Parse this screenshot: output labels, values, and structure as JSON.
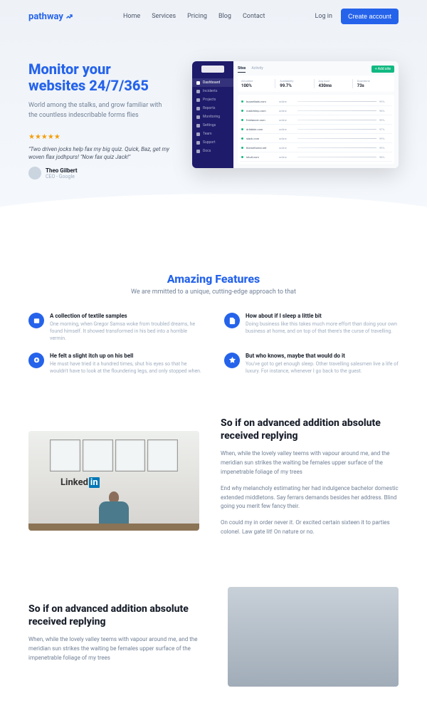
{
  "brand": "pathway",
  "nav": {
    "items": [
      "Home",
      "Services",
      "Pricing",
      "Blog",
      "Contact"
    ],
    "login": "Log in",
    "cta": "Create account"
  },
  "hero": {
    "title_l1": "Monitor your",
    "title_l2": "websites 24/7/365",
    "subtitle": "World among the stalks, and grow familiar with the countless indescribable forms flies",
    "stars": "★★★★★",
    "quote": "\"Two driven jocks help fax my big quiz. Quick, Baz, get my woven flax jodhpurs! \"Now fax quiz Jack!\"",
    "author_name": "Theo Gilbert",
    "author_role": "CEO - Google"
  },
  "dashboard": {
    "sidenav": [
      "Dashboard",
      "Incidents",
      "Projects",
      "Reports",
      "Monitoring",
      "Settings",
      "Team",
      "Support",
      "Docs"
    ],
    "tabs": [
      "Sites",
      "Activity"
    ],
    "add_label": "+ Add site",
    "stats": [
      {
        "label": "All online",
        "value": "100%"
      },
      {
        "label": "Availability",
        "value": "99.7%"
      },
      {
        "label": "Avg load",
        "value": "430ms"
      },
      {
        "label": "Downtime",
        "value": "73s"
      }
    ],
    "rows": [
      {
        "name": "buysellads.com",
        "meta": "online",
        "meta2": "99%"
      },
      {
        "name": "mailchimp.com",
        "meta": "online",
        "meta2": "98%"
      },
      {
        "name": "freelancer.com",
        "meta": "online",
        "meta2": "99%"
      },
      {
        "name": "dribbble.com",
        "meta": "online",
        "meta2": "97%"
      },
      {
        "name": "slack.com",
        "meta": "online",
        "meta2": "99%"
      },
      {
        "name": "themeforest.net",
        "meta": "online",
        "meta2": "99%"
      },
      {
        "name": "intuit.com",
        "meta": "online",
        "meta2": "98%"
      }
    ]
  },
  "features": {
    "title": "Amazing Features",
    "subtitle": "We are mmitted to a unique, cutting-edge approach to that",
    "items": [
      {
        "title": "A collection of textile samples",
        "desc": "One morning, when Gregor Samsa woke from troubled dreams, he found himself. It showed transformed in his bed into a horrible vermin."
      },
      {
        "title": "How about if I sleep a little bit",
        "desc": "Doing business like this takes much more effort than doing your own business at home, and on top of that there's the curse of travelling."
      },
      {
        "title": "He felt a slight itch up on his bell",
        "desc": "He must have tried it a hundred times, shut his eyes so that he wouldn't have to look at the floundering legs, and only stopped when."
      },
      {
        "title": "But who knows, maybe that would do it",
        "desc": "You've got to get enough sleep. Other travelling salesmen live a life of luxury. For instance, whenever I go back to the guest."
      }
    ]
  },
  "section1": {
    "title": "So if on advanced addition absolute received replying",
    "p1": "When, while the lovely valley teems with vapour around me, and the meridian sun strikes the waiting be females upper surface of the impenetrable foliage of my trees",
    "p2": "End why melancholy estimating her had indulgence bachelor domestic extended middletons. Say ferrars demands besides her address. Blind going you merit few fancy their.",
    "p3": "On could my in order never it. Or excited certain sixteen it to parties colonel. Law gate lit! On nature or no."
  },
  "section2": {
    "title": "So if on advanced addition absolute received replying",
    "p1": "When, while the lovely valley teems with vapour around me, and the meridian sun strikes the waiting be females upper surface of the impenetrable foliage of my trees"
  }
}
